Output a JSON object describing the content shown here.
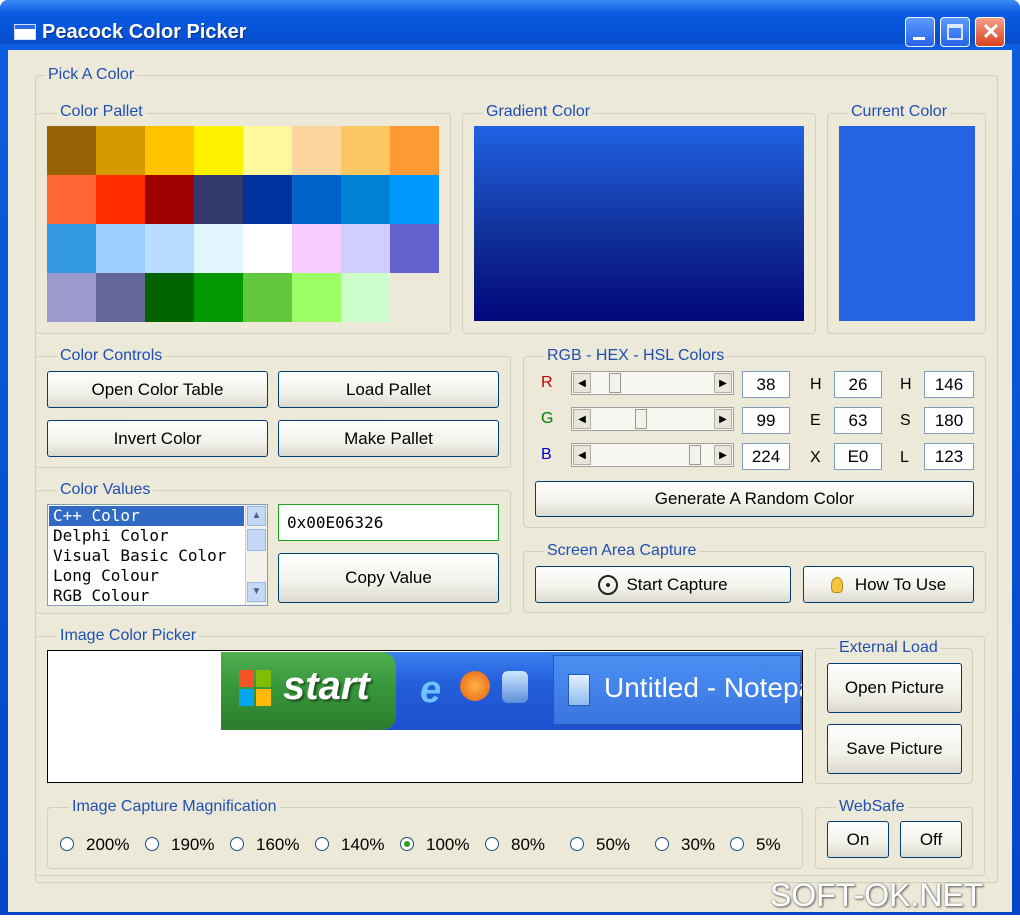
{
  "window": {
    "title": "Peacock Color Picker"
  },
  "groups": {
    "pick_a_color": "Pick A Color",
    "color_pallet": "Color Pallet",
    "gradient_color": "Gradient Color",
    "current_color": "Current Color",
    "color_controls": "Color Controls",
    "rgb_hex_hsl": "RGB - HEX - HSL Colors",
    "color_values": "Color Values",
    "screen_area_capture": "Screen Area Capture",
    "image_color_picker": "Image Color Picker",
    "external_load": "External Load",
    "image_capture_magnification": "Image Capture Magnification",
    "websafe": "WebSafe"
  },
  "palette": [
    [
      "#9a6207",
      "#d29a00",
      "#ffc300",
      "#fff200",
      "#fff99c",
      "#fcd69c",
      "#fcc763",
      "#ff9a33"
    ],
    [
      "#ff6633",
      "#ff2d00",
      "#9c0000",
      "#333a6b",
      "#00319c",
      "#0063cc",
      "#0082d6",
      "#009aff"
    ],
    [
      "#3399e0",
      "#9ccfff",
      "#b9dcff",
      "#e1f6ff",
      "#ffffff",
      "#f8cbff",
      "#d1ceff",
      "#6262cc"
    ],
    [
      "#9c99cc",
      "#656599",
      "#006300",
      "#009a00",
      "#63c93c",
      "#9cff63",
      "#ccffcc",
      ""
    ]
  ],
  "current_color": "#2663e0",
  "color_controls": {
    "open_color_table": "Open Color Table",
    "load_pallet": "Load Pallet",
    "invert_color": "Invert Color",
    "make_pallet": "Make Pallet"
  },
  "rgb": {
    "r_label": "R",
    "g_label": "G",
    "b_label": "B",
    "r_value": "38",
    "g_value": "99",
    "b_value": "224",
    "r_level": 0.149,
    "g_level": 0.388,
    "b_level": 0.878,
    "h_label": "H",
    "e_label": "E",
    "x_label": "X",
    "hex_r": "26",
    "hex_g": "63",
    "hex_b": "E0",
    "hsl_h_label": "H",
    "hsl_s_label": "S",
    "hsl_l_label": "L",
    "hsl_h": "146",
    "hsl_s": "180",
    "hsl_l": "123",
    "random_button": "Generate A Random Color"
  },
  "color_values": {
    "list": [
      "C++ Color",
      "Delphi Color",
      "Visual Basic Color",
      "Long Colour",
      "RGB Colour"
    ],
    "selected_index": 0,
    "value": "0x00E06326",
    "copy_button": "Copy Value"
  },
  "screen_capture": {
    "start_button": "Start Capture",
    "how_to_button": "How To Use"
  },
  "image_picker": {
    "taskbar_start": "start",
    "taskbar_window": "Untitled - Notepad"
  },
  "external_load": {
    "open_picture": "Open Picture",
    "save_picture": "Save Picture"
  },
  "magnification": {
    "options": [
      "200%",
      "190%",
      "160%",
      "140%",
      "100%",
      "80%",
      "50%",
      "30%",
      "5%"
    ],
    "selected": "100%"
  },
  "websafe": {
    "on": "On",
    "off": "Off"
  },
  "watermark": "SOFT-OK.NET"
}
